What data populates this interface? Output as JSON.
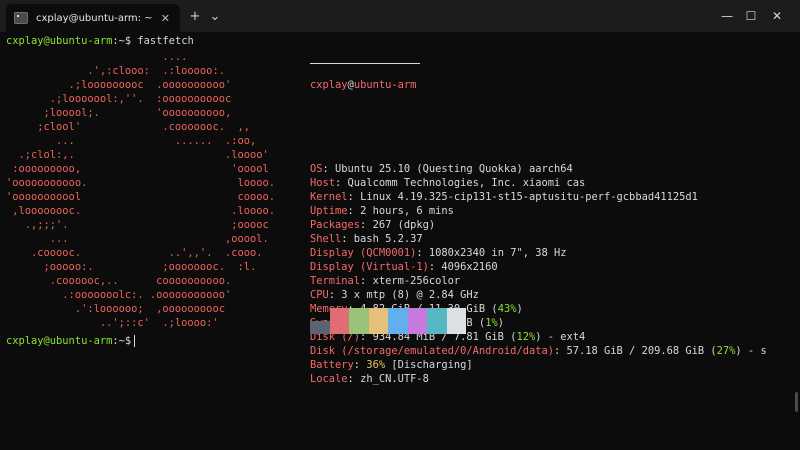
{
  "window": {
    "tab_title": "cxplay@ubuntu-arm: ~",
    "close_tab": "✕",
    "new_tab": "+",
    "dropdown": "⌄",
    "minimize": "—",
    "maximize": "☐",
    "close": "✕"
  },
  "terminal": {
    "prompt_user": "cxplay@ubuntu-arm",
    "prompt_sep": ":~$",
    "command": "fastfetch",
    "ascii_art": [
      "                         ....",
      "             .',:clooo:  .:looooo:.",
      "          .;looooooooc  .oooooooooo'",
      "       .;looooool:,''.  :ooooooooooc",
      "      ;looool;.         'oooooooooo,",
      "     ;clool'             .cooooooc.  ,,",
      "        ...                ......  .:oo,",
      "  .;clol:,.                        .loooo'",
      " :ooooooooo,                        'ooool",
      "'ooooooooooo.                        loooo.",
      "'ooooooooool                         coooo.",
      " ,loooooooc.                        .loooo.",
      "   .,;;;'.                          ;ooooc",
      "       ...                         ,ooool.",
      "    .cooooc.              ..',,'.  .cooo.",
      "      ;ooooo:.           ;oooooooc.  :l.",
      "       .coooooc,..      coooooooooo.",
      "         .:ooooooolc:. .ooooooooooo'",
      "           .':loooooo;  ,oooooooooc",
      "               ..';::c'  .;loooo:'"
    ],
    "info": {
      "user": "cxplay",
      "at": "@",
      "host": "ubuntu-arm",
      "rows": [
        {
          "key": "OS",
          "value": "Ubuntu 25.10 (Questing Quokka) aarch64"
        },
        {
          "key": "Host",
          "value": "Qualcomm Technologies, Inc. xiaomi cas"
        },
        {
          "key": "Kernel",
          "value": "Linux 4.19.325-cip131-st15-aptusitu-perf-gcbbad41125d1"
        },
        {
          "key": "Uptime",
          "value": "2 hours, 6 mins"
        },
        {
          "key": "Packages",
          "value": "267 (dpkg)"
        },
        {
          "key": "Shell",
          "value": "bash 5.2.37"
        },
        {
          "key": "Display (QCM0001)",
          "value": "1080x2340 in 7\", 38 Hz"
        },
        {
          "key": "Display (Virtual-1)",
          "value": "4096x2160"
        },
        {
          "key": "Terminal",
          "value": "xterm-256color"
        },
        {
          "key": "CPU",
          "value": "3 x mtp (8) @ 2.84 GHz"
        },
        {
          "key": "Memory",
          "value": "4.82 GiB / 11.30 GiB (",
          "pct": "43%",
          "tail": ")"
        },
        {
          "key": "Swap",
          "value": "18.75 MiB / 2.00 GiB (",
          "pct": "1%",
          "tail": ")"
        },
        {
          "key": "Disk (/)",
          "value": "934.84 MiB / 7.81 GiB (",
          "pct": "12%",
          "tail": ") - ext4"
        },
        {
          "key": "Disk (/storage/emulated/0/Android/data)",
          "value": "57.18 GiB / 209.68 GiB (",
          "pct": "27%",
          "tail": ") - s"
        },
        {
          "key": "Battery",
          "pre": "",
          "pct": "36%",
          "value": "",
          "tail": " [Discharging]",
          "battery": true
        },
        {
          "key": "Locale",
          "value": "zh_CN.UTF-8"
        }
      ]
    },
    "colors": {
      "swatches": [
        "#5c6370",
        "#e06c75",
        "#98c379",
        "#e5c07b",
        "#61afef",
        "#c678dd",
        "#56b6c2",
        "#dcdfe4"
      ]
    }
  }
}
